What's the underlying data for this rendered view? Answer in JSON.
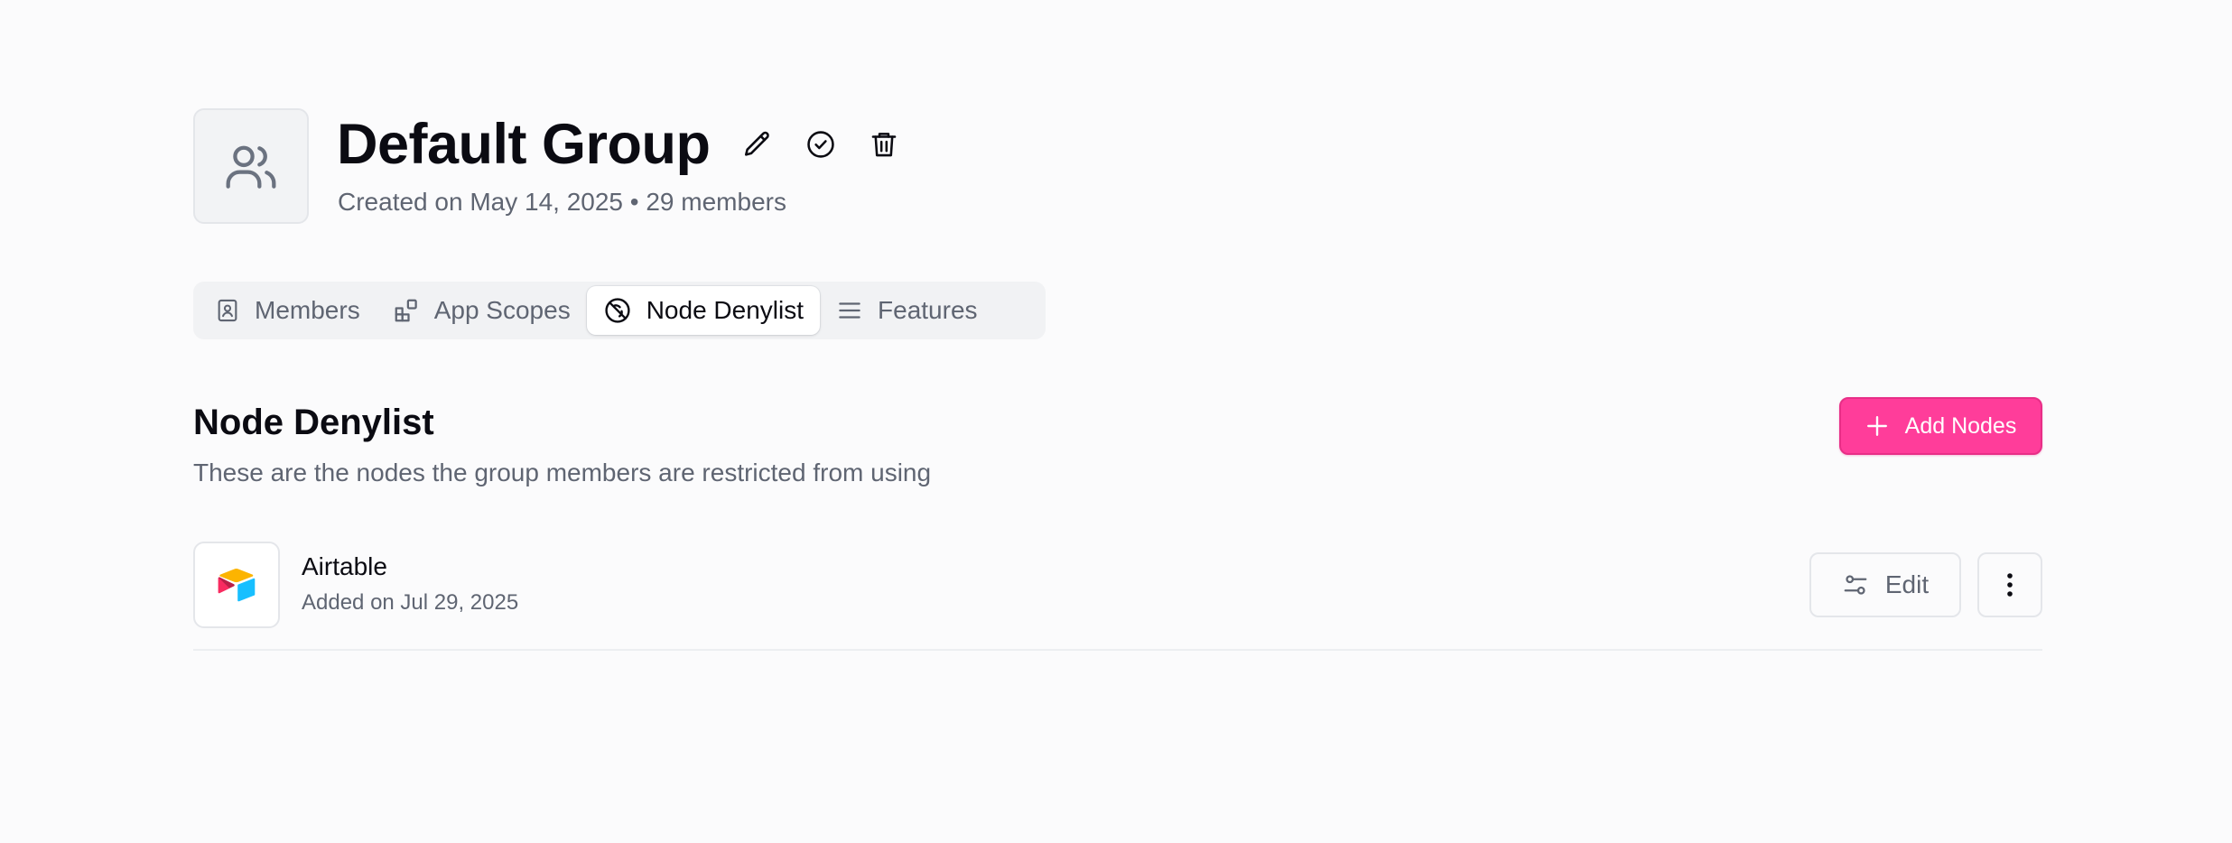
{
  "group": {
    "icon": "users-icon",
    "title": "Default Group",
    "meta": "Created on May 14, 2025 • 29 members",
    "actions": [
      {
        "name": "edit-title-button",
        "icon": "pencil-icon"
      },
      {
        "name": "set-default-button",
        "icon": "check-circle-icon"
      },
      {
        "name": "delete-group-button",
        "icon": "trash-icon"
      }
    ]
  },
  "tabs": [
    {
      "label": "Members",
      "icon": "contact-book-icon",
      "active": false
    },
    {
      "label": "App Scopes",
      "icon": "apps-grid-icon",
      "active": false
    },
    {
      "label": "Node Denylist",
      "icon": "ban-icon",
      "active": true
    },
    {
      "label": "Features",
      "icon": "list-icon",
      "active": false
    }
  ],
  "section": {
    "title": "Node Denylist",
    "description": "These are the nodes the group members are restricted from using",
    "add_button_label": "Add Nodes",
    "add_button_icon": "plus-icon"
  },
  "nodes": [
    {
      "name": "Airtable",
      "added": "Added on Jul 29, 2025",
      "logo": "airtable-logo-icon",
      "edit_label": "Edit",
      "edit_icon": "sliders-icon",
      "more_icon": "more-vertical-icon"
    }
  ],
  "colors": {
    "accent": "#ff3d9a",
    "text_primary": "#0b0b12",
    "text_secondary": "#5f6572",
    "background": "#fbfbfc",
    "border": "#e4e6ea"
  }
}
